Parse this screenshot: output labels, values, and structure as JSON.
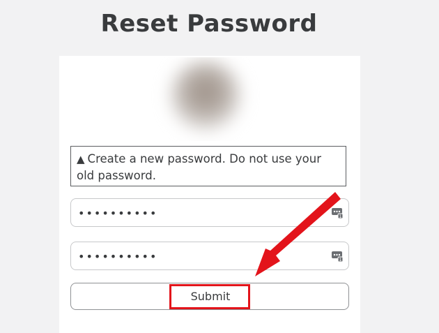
{
  "page": {
    "title": "Reset Password"
  },
  "notice": {
    "text": "Create a new password. Do not use your old password.",
    "icon": "warning-icon"
  },
  "fields": {
    "new_password_value": "••••••••••",
    "confirm_password_value": "••••••••••",
    "icon": "password-manager-icon"
  },
  "submit": {
    "label": "Submit"
  },
  "annotation": {
    "color": "#e3141b"
  }
}
